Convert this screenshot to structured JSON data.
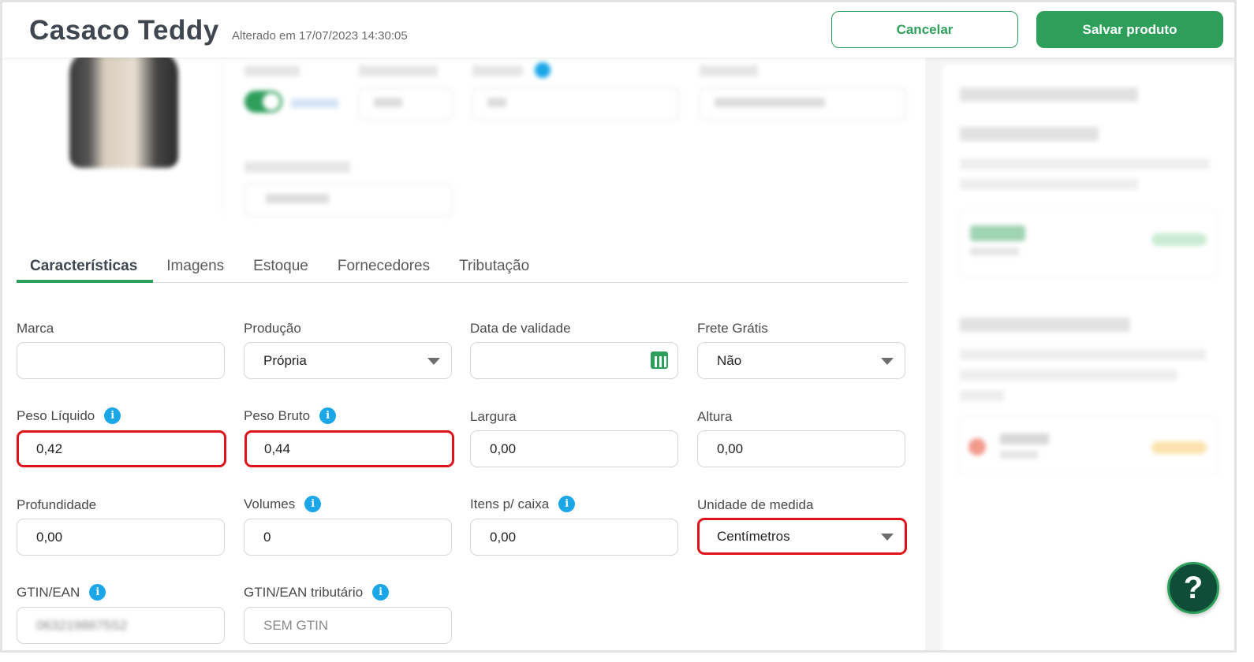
{
  "header": {
    "title": "Casaco Teddy",
    "subtitle": "Alterado em 17/07/2023 14:30:05",
    "cancel_label": "Cancelar",
    "save_label": "Salvar produto"
  },
  "tabs": [
    {
      "label": "Características",
      "active": true
    },
    {
      "label": "Imagens"
    },
    {
      "label": "Estoque"
    },
    {
      "label": "Fornecedores"
    },
    {
      "label": "Tributação"
    }
  ],
  "form": {
    "marca": {
      "label": "Marca",
      "value": ""
    },
    "producao": {
      "label": "Produção",
      "value": "Própria"
    },
    "validade": {
      "label": "Data de validade",
      "value": ""
    },
    "frete": {
      "label": "Frete Grátis",
      "value": "Não"
    },
    "peso_liquido": {
      "label": "Peso Líquido",
      "value": "0,42"
    },
    "peso_bruto": {
      "label": "Peso Bruto",
      "value": "0,44"
    },
    "largura": {
      "label": "Largura",
      "value": "0,00"
    },
    "altura": {
      "label": "Altura",
      "value": "0,00"
    },
    "profundidade": {
      "label": "Profundidade",
      "value": "0,00"
    },
    "volumes": {
      "label": "Volumes",
      "value": "0"
    },
    "itens_caixa": {
      "label": "Itens p/ caixa",
      "value": "0,00"
    },
    "unidade": {
      "label": "Unidade de medida",
      "value": "Centímetros"
    },
    "gtin": {
      "label": "GTIN/EAN",
      "value": "0632198875S2"
    },
    "gtin_trib": {
      "label": "GTIN/EAN tributário",
      "placeholder": "SEM GTIN"
    }
  },
  "help_label": "?",
  "colors": {
    "brand_green": "#2e9e5b",
    "info_blue": "#1ba6e8",
    "highlight_red": "#e1111b",
    "help_dark": "#0f4d39"
  }
}
